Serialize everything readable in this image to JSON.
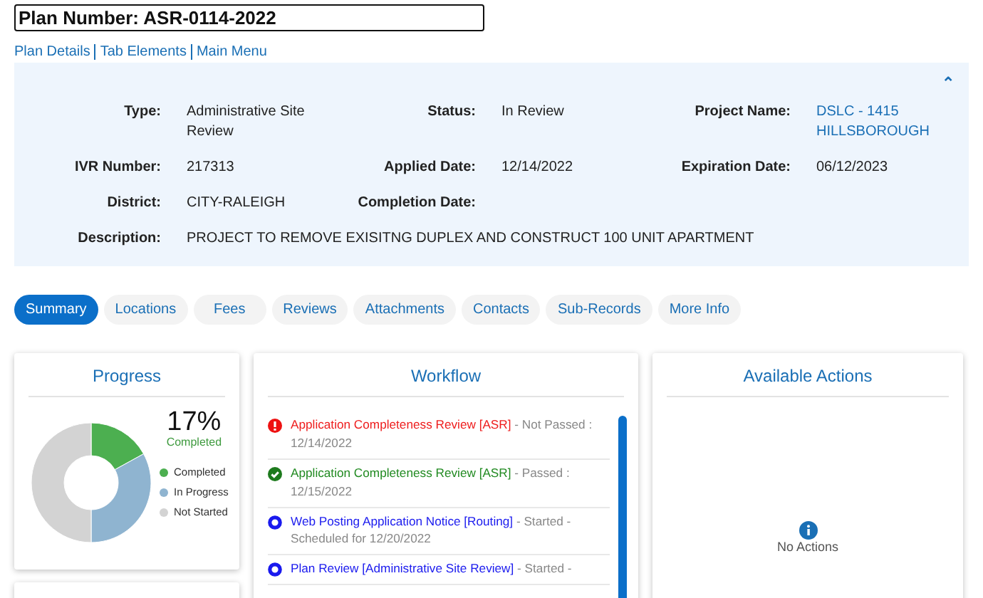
{
  "plan_title": "Plan Number: ASR-0114-2022",
  "nav_links": [
    "Plan Details",
    "Tab Elements",
    "Main Menu"
  ],
  "details": {
    "collapse_icon": "⌃",
    "fields": [
      {
        "label": "Type:",
        "value": "Administrative Site Review",
        "kind": "text"
      },
      {
        "label": "Status:",
        "value": "In Review",
        "kind": "text"
      },
      {
        "label": "Project Name:",
        "value": "DSLC - 1415 HILLSBOROUGH",
        "kind": "link"
      },
      {
        "label": "IVR Number:",
        "value": "217313",
        "kind": "text"
      },
      {
        "label": "Applied Date:",
        "value": "12/14/2022",
        "kind": "text"
      },
      {
        "label": "Expiration Date:",
        "value": "06/12/2023",
        "kind": "text"
      },
      {
        "label": "District:",
        "value": "CITY-RALEIGH",
        "kind": "text"
      },
      {
        "label": "Completion Date:",
        "kind": "text"
      }
    ],
    "description": {
      "label": "Description:",
      "value": "PROJECT TO REMOVE EXISITNG DUPLEX AND CONSTRUCT 100 UNIT APARTMENT"
    }
  },
  "tabs": [
    {
      "label": "Summary",
      "selected": true
    },
    {
      "label": "Locations",
      "selected": false
    },
    {
      "label": "Fees",
      "selected": false
    },
    {
      "label": "Reviews",
      "selected": false
    },
    {
      "label": "Attachments",
      "selected": false
    },
    {
      "label": "Contacts",
      "selected": false
    },
    {
      "label": "Sub-Records",
      "selected": false
    },
    {
      "label": "More Info",
      "selected": false
    }
  ],
  "progress": {
    "title": "Progress",
    "percent": "17%",
    "percent_caption": "Completed",
    "chart_data": {
      "type": "donut",
      "categories": [
        "Completed",
        "In Progress",
        "Not Started"
      ],
      "values": [
        17,
        33,
        50
      ]
    },
    "legend": [
      {
        "color": "#4caf50"
      },
      {
        "color": "#8fb4d0"
      },
      {
        "color": "#d3d3d3"
      }
    ]
  },
  "workflow": {
    "title": "Workflow",
    "items": [
      {
        "task": "Application Completeness Review [ASR]",
        "status": "- Not Passed : 12/14/2022",
        "kind": "failed"
      },
      {
        "task": "Application Completeness Review [ASR]",
        "status": "- Passed : 12/15/2022",
        "kind": "passed"
      },
      {
        "task": "Web Posting Application Notice [Routing]",
        "status": "- Started - Scheduled for 12/20/2022",
        "kind": "started"
      },
      {
        "task": "Plan Review [Administrative Site Review]",
        "status": "- Started -",
        "kind": "started"
      }
    ]
  },
  "actions": {
    "title": "Available Actions",
    "empty_text": "No Actions"
  }
}
